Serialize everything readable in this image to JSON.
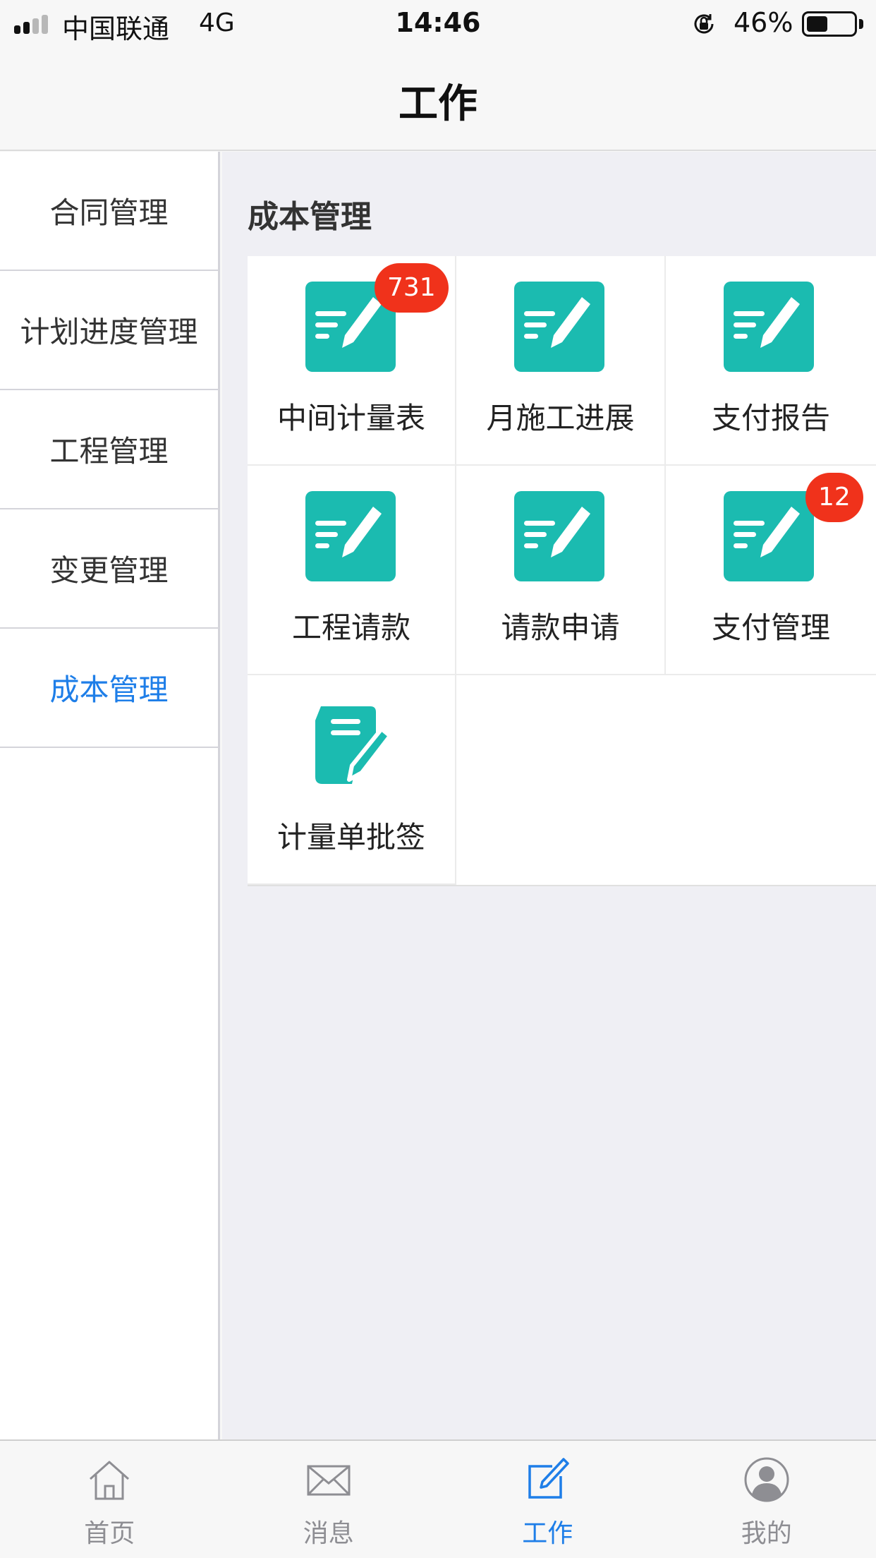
{
  "status_bar": {
    "carrier": "中国联通",
    "network": "4G",
    "time": "14:46",
    "battery_percent": "46%",
    "battery_level": 0.46
  },
  "header": {
    "title": "工作"
  },
  "sidebar": {
    "items": [
      {
        "label": "合同管理",
        "active": false
      },
      {
        "label": "计划进度管理",
        "active": false
      },
      {
        "label": "工程管理",
        "active": false
      },
      {
        "label": "变更管理",
        "active": false
      },
      {
        "label": "成本管理",
        "active": true
      }
    ]
  },
  "main": {
    "section_title": "成本管理",
    "tiles": [
      {
        "label": "中间计量表",
        "badge": "731",
        "icon": "edit-note-icon"
      },
      {
        "label": "月施工进展",
        "icon": "edit-note-icon"
      },
      {
        "label": "支付报告",
        "icon": "edit-note-icon"
      },
      {
        "label": "工程请款",
        "icon": "edit-note-icon"
      },
      {
        "label": "请款申请",
        "icon": "edit-note-icon"
      },
      {
        "label": "支付管理",
        "badge": "12",
        "icon": "edit-note-icon"
      },
      {
        "label": "计量单批签",
        "icon": "sign-document-icon"
      }
    ]
  },
  "tab_bar": {
    "tabs": [
      {
        "label": "首页",
        "icon": "home-icon",
        "active": false
      },
      {
        "label": "消息",
        "icon": "envelope-icon",
        "active": false
      },
      {
        "label": "工作",
        "icon": "edit-icon",
        "active": true
      },
      {
        "label": "我的",
        "icon": "user-icon",
        "active": false
      }
    ]
  },
  "colors": {
    "accent": "#1e7ee8",
    "icon_teal": "#1bbbb0",
    "badge_red": "#f0321b",
    "inactive_tab": "#8e8e93"
  }
}
